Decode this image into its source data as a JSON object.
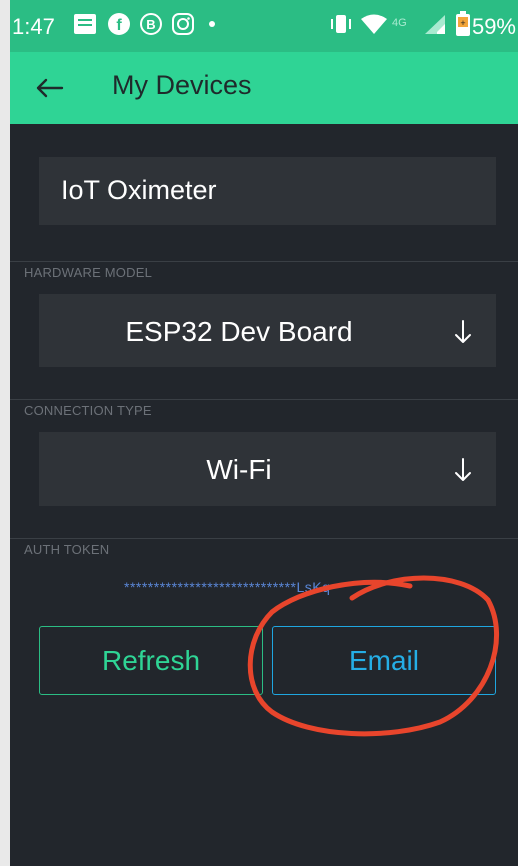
{
  "status_bar": {
    "time": "1:47",
    "battery_percent": "59%",
    "icons": [
      "message-icon",
      "facebook-icon",
      "bitcoin-icon",
      "instagram-icon",
      "dot-icon",
      "vibrate-icon",
      "wifi-icon",
      "network-icon",
      "signal-icon",
      "battery-icon"
    ]
  },
  "app_bar": {
    "title": "My Devices",
    "back_icon": "back-arrow-icon"
  },
  "form": {
    "device_name": "IoT Oximeter",
    "hardware_model_label": "HARDWARE MODEL",
    "hardware_model_value": "ESP32 Dev Board",
    "connection_type_label": "CONNECTION TYPE",
    "connection_type_value": "Wi-Fi",
    "auth_token_label": "AUTH TOKEN",
    "auth_token_value": "*****************************LsKq"
  },
  "buttons": {
    "refresh_label": "Refresh",
    "email_label": "Email"
  },
  "colors": {
    "status_bar": "#2bbd84",
    "app_bar": "#2fd495",
    "background": "#22262c",
    "field": "#2f3338",
    "refresh": "#2fd495",
    "email": "#25aee6",
    "annotation": "#e8452c"
  }
}
